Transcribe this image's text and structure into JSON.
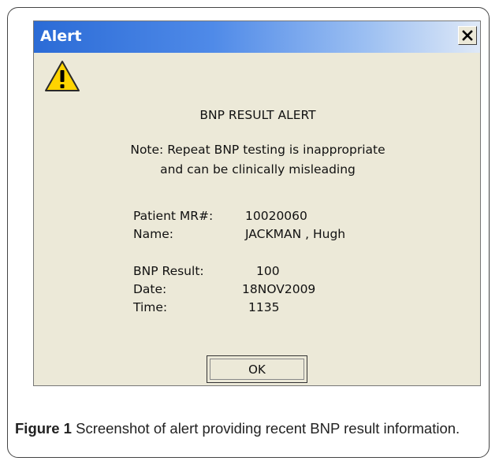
{
  "dialog": {
    "title": "Alert",
    "close_glyph": "✕",
    "icon": "warning-icon",
    "heading": "BNP RESULT ALERT",
    "note_line1": "Note: Repeat BNP testing is inappropriate",
    "note_line2": "and can be clinically misleading",
    "fields": {
      "mrn_label": "Patient MR#:",
      "mrn_value": "10020060",
      "name_label": "Name:",
      "name_value": "JACKMAN , Hugh",
      "bnp_label": "BNP Result:",
      "bnp_value": "100",
      "date_label": "Date:",
      "date_value": "18NOV2009",
      "time_label": "Time:",
      "time_value": "1135"
    },
    "ok_label": "OK"
  },
  "caption": {
    "label": "Figure 1",
    "text": " Screenshot of alert providing recent BNP result information."
  },
  "colors": {
    "titlebar_start": "#2b6bd6",
    "titlebar_end": "#dfe9f7",
    "dialog_bg": "#ece9d8",
    "warning_yellow": "#ffd400"
  }
}
